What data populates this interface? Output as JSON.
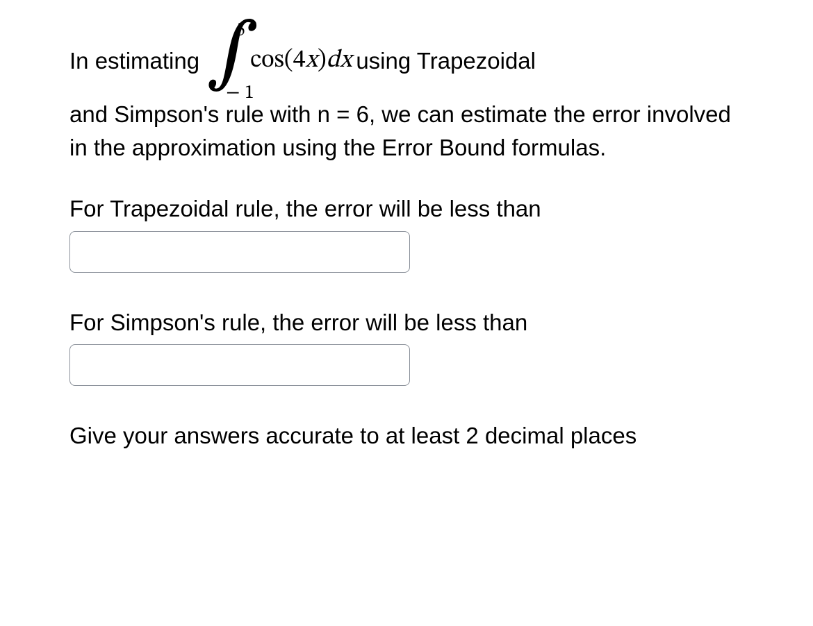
{
  "problem": {
    "intro_prefix": "In estimating ",
    "integral": {
      "upper": "5",
      "lower": "− 1",
      "integrand_func": "cos",
      "integrand_arg_open": "(",
      "integrand_coef": "4",
      "integrand_var": "x",
      "integrand_arg_close": ")",
      "integrand_d": "d",
      "integrand_dvar": "x"
    },
    "intro_suffix": " using Trapezoidal",
    "intro_cont": "and Simpson's rule with n = 6, we can estimate the error involved in the approximation using the Error Bound formulas.",
    "trap_label": "For Trapezoidal rule, the error will be less than",
    "simp_label": "For Simpson's rule, the error will be less than",
    "note": "Give your answers accurate to at least 2 decimal places"
  },
  "inputs": {
    "trapezoidal_value": "",
    "simpson_value": ""
  }
}
